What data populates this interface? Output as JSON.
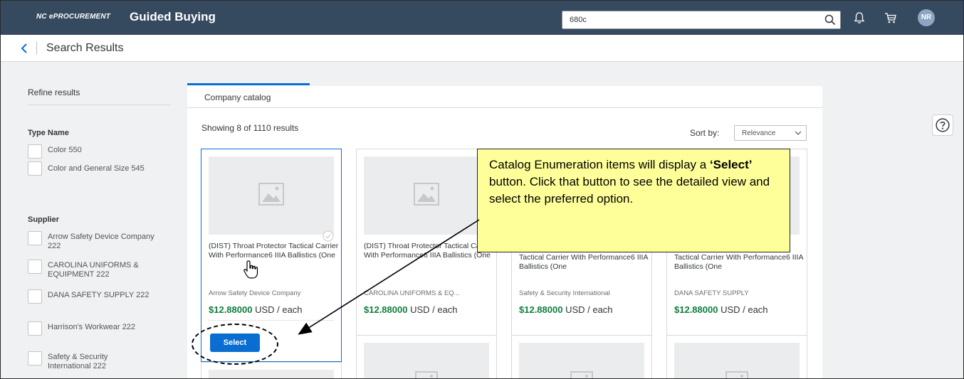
{
  "header": {
    "org": "NC ePROCUREMENT",
    "app_title": "Guided Buying",
    "search_value": "680c",
    "avatar_initials": "NR"
  },
  "subheader": {
    "title": "Search Results"
  },
  "sidebar": {
    "refine_title": "Refine results",
    "type_name_title": "Type Name",
    "type_items": [
      {
        "label": "Color  550"
      },
      {
        "label": "Color and General Size  545"
      }
    ],
    "supplier_title": "Supplier",
    "supplier_items": [
      {
        "label": "Arrow Safety Device Company  222"
      },
      {
        "label": "CAROLINA UNIFORMS & EQUIPMENT  222"
      },
      {
        "label": "DANA SAFETY SUPPLY  222"
      },
      {
        "label": "Harrison's Workwear  222"
      },
      {
        "label": "Safety & Security International  222"
      }
    ]
  },
  "main": {
    "tab_label": "Company catalog",
    "showing": "Showing 8 of 1110 results",
    "sort_label": "Sort by:",
    "sort_value": "Relevance",
    "select_label": "Select",
    "cards": [
      {
        "title": "(DIST) Throat Protector Tactical Carrier With Performance6 IIIA Ballistics (One",
        "supplier": "Arrow Safety Device Company",
        "price": "$12.88000",
        "unit": " USD / each"
      },
      {
        "title": "(DIST) Throat Protector Tactical Carrier With Performance6 IIIA Ballistics (One",
        "supplier": "CAROLINA UNIFORMS & EQ...",
        "price": "$12.88000",
        "unit": " USD / each"
      },
      {
        "title": "Tactical Carrier With Performance6 IIIA Ballistics (One",
        "supplier": "Safety & Security International",
        "price": "$12.88000",
        "unit": " USD / each"
      },
      {
        "title": "Tactical Carrier With Performance6 IIIA Ballistics (One",
        "supplier": "DANA SAFETY SUPPLY",
        "price": "$12.88000",
        "unit": " USD / each"
      }
    ]
  },
  "callout": {
    "line1": "Catalog Enumeration items will display a ",
    "bold": "‘Select’",
    "line2": " button.  Click that button to see the detailed view and select the preferred option."
  },
  "colors": {
    "header_bg": "#354a5f",
    "accent": "#0a6ed1",
    "price_green": "#107e3e",
    "callout_bg": "#ffff99"
  }
}
